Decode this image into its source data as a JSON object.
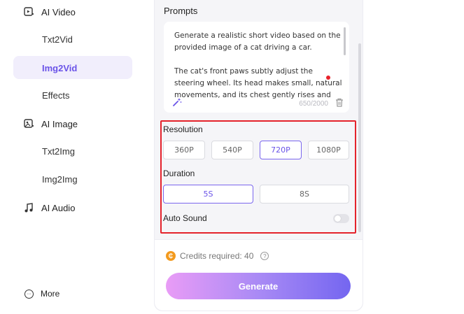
{
  "sidebar": {
    "ai_video": "AI Video",
    "txt2vid": "Txt2Vid",
    "img2vid": "Img2Vid",
    "effects": "Effects",
    "ai_image": "AI Image",
    "txt2img": "Txt2Img",
    "img2img": "Img2Img",
    "ai_audio": "AI Audio",
    "more": "More",
    "active_item": "Img2Vid"
  },
  "prompts": {
    "title": "Prompts",
    "text": "Generate a realistic short video based on the provided image of a cat driving a car.\n\nThe cat's front paws subtly adjust the steering wheel. Its head makes small, natural movements, and its chest gently rises and",
    "char_count": "650/2000"
  },
  "resolution": {
    "label": "Resolution",
    "options": [
      "360P",
      "540P",
      "720P",
      "1080P"
    ],
    "selected": "720P"
  },
  "duration": {
    "label": "Duration",
    "options": [
      "5S",
      "8S"
    ],
    "selected": "5S"
  },
  "auto_sound": {
    "label": "Auto Sound",
    "enabled": false
  },
  "credits": {
    "text": "Credits required: 40"
  },
  "generate": {
    "label": "Generate"
  },
  "colors": {
    "accent": "#6a53e8",
    "highlight_border": "#e4222b",
    "coin": "#f39a1e"
  }
}
